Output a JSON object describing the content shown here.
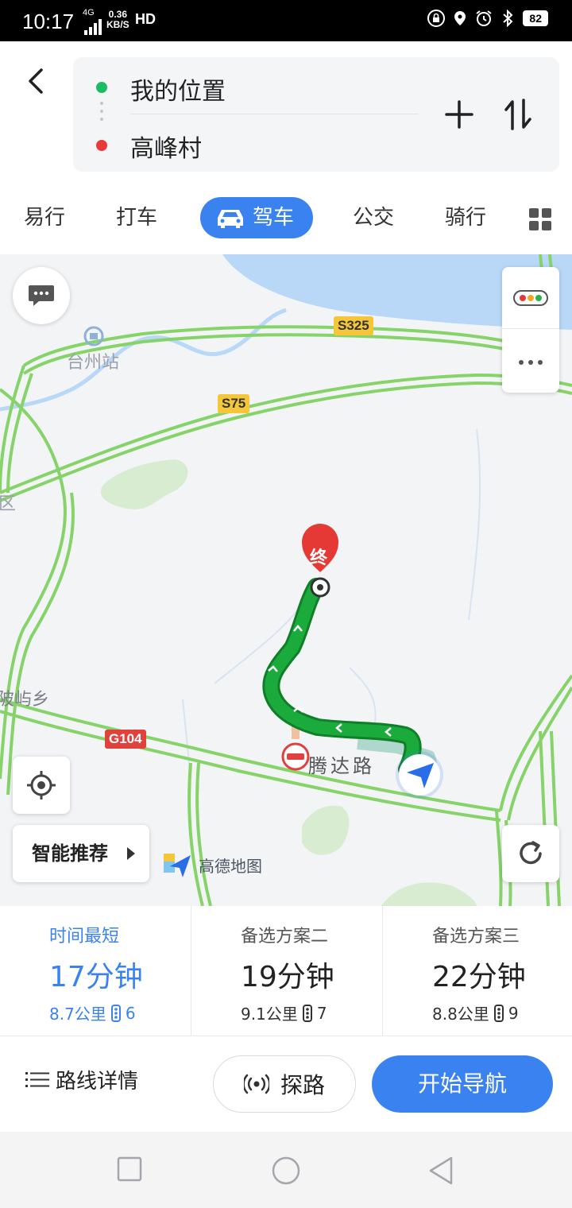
{
  "status_bar": {
    "time": "10:17",
    "network": "4G",
    "speed_value": "0.36",
    "speed_unit": "KB/S",
    "hd": "HD",
    "battery": "82"
  },
  "header": {
    "origin": "我的位置",
    "destination": "高峰村",
    "origin_color": "#1ebc62",
    "destination_color": "#e93a3a"
  },
  "mode_tabs": [
    {
      "label": "易行",
      "selected": false
    },
    {
      "label": "打车",
      "selected": false
    },
    {
      "label": "驾车",
      "selected": true
    },
    {
      "label": "公交",
      "selected": false
    },
    {
      "label": "骑行",
      "selected": false
    }
  ],
  "map": {
    "place_labels": {
      "station": "台州站",
      "district": "区",
      "township": "陂屿乡",
      "road": "腾达路"
    },
    "shields": {
      "s325": "S325",
      "s75": "S75",
      "g104": "G104"
    },
    "end_marker": "终",
    "smart_recommend": "智能推荐",
    "logo_text": "高德地图",
    "route_color": "#1aab3c",
    "accent_color": "#3b82f1"
  },
  "route_options": [
    {
      "label": "时间最短",
      "time": "17分钟",
      "distance": "8.7公里",
      "lights": "6",
      "selected": true
    },
    {
      "label": "备选方案二",
      "time": "19分钟",
      "distance": "9.1公里",
      "lights": "7",
      "selected": false
    },
    {
      "label": "备选方案三",
      "time": "22分钟",
      "distance": "8.8公里",
      "lights": "9",
      "selected": false
    }
  ],
  "actions": {
    "route_detail": "路线详情",
    "explore": "探路",
    "start_navigation": "开始导航"
  }
}
